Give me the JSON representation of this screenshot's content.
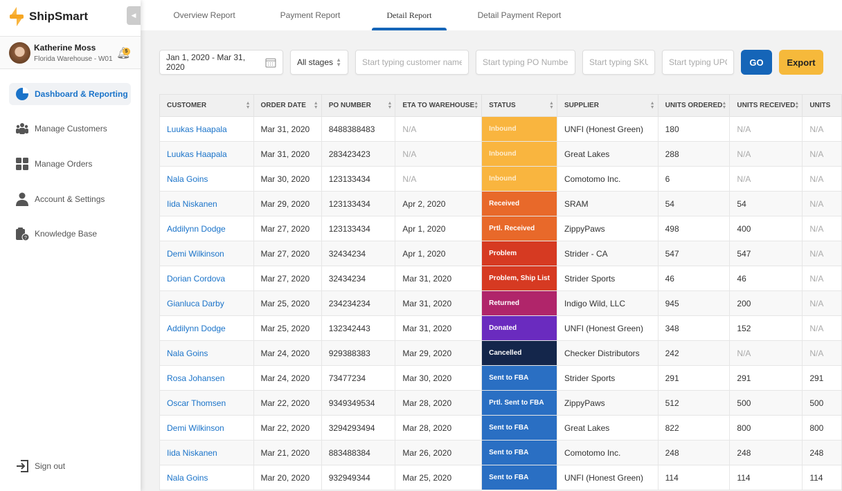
{
  "app": {
    "name": "ShipSmart"
  },
  "user": {
    "name": "Katherine Moss",
    "warehouse": "Florida Warehouse - W01",
    "notifications": "5"
  },
  "sidebar": {
    "items": [
      {
        "label": "Dashboard & Reporting",
        "icon": "pie-chart-icon",
        "active": true
      },
      {
        "label": "Manage Customers",
        "icon": "users-icon"
      },
      {
        "label": "Manage Orders",
        "icon": "grid-icon"
      },
      {
        "label": "Account & Settings",
        "icon": "user-icon"
      },
      {
        "label": "Knowledge Base",
        "icon": "clipboard-question-icon"
      }
    ],
    "sign_out": "Sign out"
  },
  "tabs": [
    {
      "label": "Overview Report"
    },
    {
      "label": "Payment Report"
    },
    {
      "label": "Detail Report",
      "active": true
    },
    {
      "label": "Detail Payment Report"
    }
  ],
  "filters": {
    "date_range": "Jan 1, 2020 - Mar 31, 2020",
    "stage": "All stages",
    "customer_placeholder": "Start typing customer name",
    "po_placeholder": "Start typing PO Number",
    "sku_placeholder": "Start typing SKU",
    "upc_placeholder": "Start typing UPC",
    "go": "GO",
    "export": "Export"
  },
  "colors": {
    "accent": "#1565b8",
    "export": "#f6b93b",
    "inbound": "#f9b53f",
    "received": "#e8692a",
    "problem": "#d63a22",
    "returned": "#b0256a",
    "donated": "#6a2bbf",
    "cancelled": "#14264b",
    "fba": "#2a6fc3"
  },
  "table": {
    "columns": [
      "CUSTOMER",
      "ORDER DATE",
      "PO NUMBER",
      "ETA TO WAREHOUSE",
      "STATUS",
      "SUPPLIER",
      "UNITS ORDERED",
      "UNITS RECEIVED",
      "UNITS"
    ],
    "rows": [
      [
        "Luukas Haapala",
        "Mar 31, 2020",
        "8488388483",
        "N/A",
        "Inbound",
        "UNFI (Honest Green)",
        "180",
        "N/A",
        "N/A"
      ],
      [
        "Luukas Haapala",
        "Mar 31, 2020",
        "283423423",
        "N/A",
        "Inbound",
        "Great Lakes",
        "288",
        "N/A",
        "N/A"
      ],
      [
        "Nala Goins",
        "Mar 30, 2020",
        "123133434",
        "N/A",
        "Inbound",
        "Comotomo Inc.",
        "6",
        "N/A",
        "N/A"
      ],
      [
        "Iida Niskanen",
        "Mar 29, 2020",
        "123133434",
        "Apr 2, 2020",
        "Received",
        "SRAM",
        "54",
        "54",
        "N/A"
      ],
      [
        "Addilynn Dodge",
        "Mar 27, 2020",
        "123133434",
        "Apr 1, 2020",
        "Prtl. Received",
        "ZippyPaws",
        "498",
        "400",
        "N/A"
      ],
      [
        "Demi Wilkinson",
        "Mar 27, 2020",
        "32434234",
        "Apr 1, 2020",
        "Problem",
        "Strider - CA",
        "547",
        "547",
        "N/A"
      ],
      [
        "Dorian Cordova",
        "Mar 27, 2020",
        "32434234",
        "Mar 31, 2020",
        "Problem, Ship List",
        "Strider Sports",
        "46",
        "46",
        "N/A"
      ],
      [
        "Gianluca Darby",
        "Mar 25, 2020",
        "234234234",
        "Mar 31, 2020",
        "Returned",
        "Indigo Wild, LLC",
        "945",
        "200",
        "N/A"
      ],
      [
        "Addilynn Dodge",
        "Mar 25, 2020",
        "132342443",
        "Mar 31, 2020",
        "Donated",
        "UNFI (Honest Green)",
        "348",
        "152",
        "N/A"
      ],
      [
        "Nala Goins",
        "Mar 24, 2020",
        "929388383",
        "Mar 29, 2020",
        "Cancelled",
        "Checker Distributors",
        "242",
        "N/A",
        "N/A"
      ],
      [
        "Rosa Johansen",
        "Mar 24, 2020",
        "73477234",
        "Mar 30, 2020",
        "Sent to FBA",
        "Strider Sports",
        "291",
        "291",
        "291"
      ],
      [
        "Oscar Thomsen",
        "Mar 22, 2020",
        "9349349534",
        "Mar 28, 2020",
        "Prtl. Sent to FBA",
        "ZippyPaws",
        "512",
        "500",
        "500"
      ],
      [
        "Demi Wilkinson",
        "Mar 22, 2020",
        "3294293494",
        "Mar 28, 2020",
        "Sent to FBA",
        "Great Lakes",
        "822",
        "800",
        "800"
      ],
      [
        "Iida Niskanen",
        "Mar 21, 2020",
        "883488384",
        "Mar 26, 2020",
        "Sent to FBA",
        "Comotomo Inc.",
        "248",
        "248",
        "248"
      ],
      [
        "Nala Goins",
        "Mar 20, 2020",
        "932949344",
        "Mar 25, 2020",
        "Sent to FBA",
        "UNFI (Honest Green)",
        "114",
        "114",
        "114"
      ]
    ]
  }
}
